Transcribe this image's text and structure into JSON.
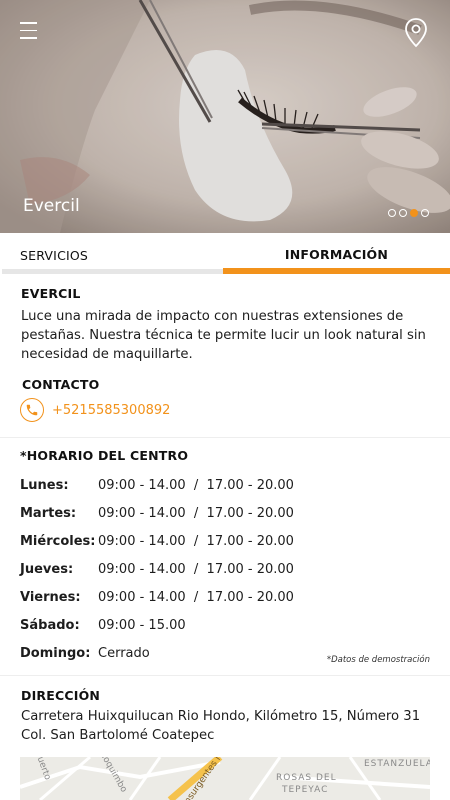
{
  "hero": {
    "title": "Evercil",
    "slides": [
      false,
      false,
      true,
      false
    ]
  },
  "tabs": {
    "services": "SERVICIOS",
    "info": "INFORMACIÓN"
  },
  "about": {
    "heading": "EVERCIL",
    "text": "Luce una mirada de impacto con nuestras extensiones de pestañas. Nuestra técnica te permite lucir un look natural sin necesidad de maquillarte."
  },
  "contact": {
    "heading": "CONTACTO",
    "phone": "+5215585300892"
  },
  "hours": {
    "heading": "*HORARIO DEL CENTRO",
    "rows": [
      {
        "day": "Lunes:",
        "time": "09:00 - 14.00  /  17.00 - 20.00"
      },
      {
        "day": "Martes:",
        "time": "09:00 - 14.00  /  17.00 - 20.00"
      },
      {
        "day": "Miércoles:",
        "time": "09:00 - 14.00  /  17.00 - 20.00"
      },
      {
        "day": "Jueves:",
        "time": "09:00 - 14.00  /  17.00 - 20.00"
      },
      {
        "day": "Viernes:",
        "time": "09:00 - 14.00  /  17.00 - 20.00"
      },
      {
        "day": "Sábado:",
        "time": "09:00 - 15.00"
      },
      {
        "day": "Domingo:",
        "time": "Cerrado"
      }
    ],
    "note": "*Datos de demostración"
  },
  "address": {
    "heading": "DIRECCIÓN",
    "line1": "Carretera Huixquilucan Rio Hondo, Kilómetro 15, Número 31",
    "line2": "Col. San Bartolomé Coatepec"
  },
  "map": {
    "labels": [
      "Coquimbo",
      "Insurgentes Nte",
      "ROSAS DEL",
      "TEPEYAC",
      "ESTANZUELA",
      "Puerto"
    ]
  },
  "colors": {
    "accent": "#f2921b",
    "tab_inactive_bar": "#e6e6e6"
  }
}
